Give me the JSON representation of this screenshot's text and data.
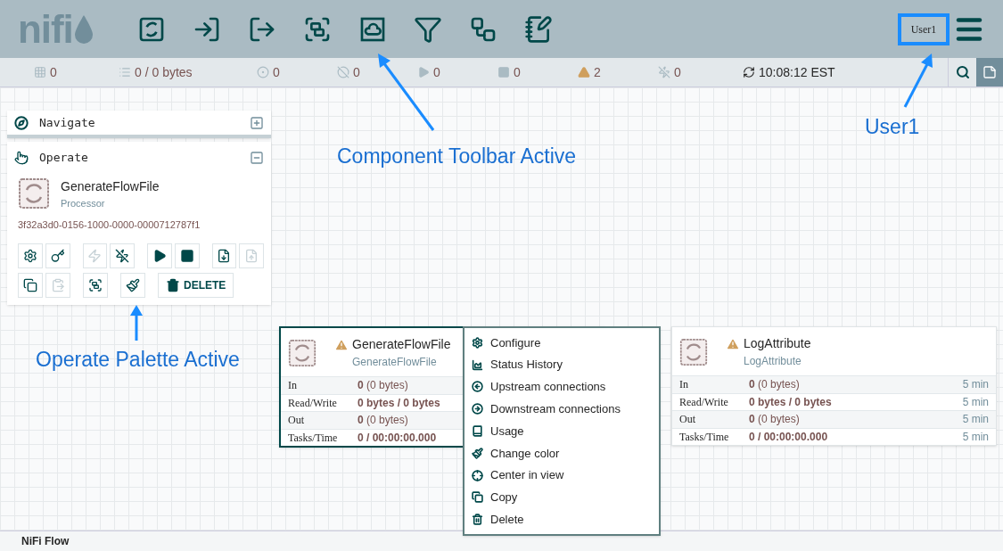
{
  "header": {
    "logo": "nifi",
    "user": "User1"
  },
  "status_bar": [
    {
      "text": "0"
    },
    {
      "text": "0 / 0 bytes"
    },
    {
      "text": "0"
    },
    {
      "text": "0"
    },
    {
      "text": "0"
    },
    {
      "text": "0"
    },
    {
      "text": "2"
    },
    {
      "text": "0"
    },
    {
      "text": "10:08:12 EST"
    }
  ],
  "navigate": {
    "title": "Navigate",
    "expanded": false
  },
  "operate": {
    "title": "Operate",
    "expanded": true,
    "name": "GenerateFlowFile",
    "type": "Processor",
    "id": "3f32a3d0-0156-1000-0000-0000712787f1",
    "buttons": [
      {
        "disabled": false
      },
      {
        "disabled": false
      },
      {
        "disabled": true
      },
      {
        "disabled": false
      },
      {
        "disabled": false
      },
      {
        "disabled": false
      },
      {
        "disabled": false
      },
      {
        "disabled": true
      },
      {
        "disabled": false
      },
      {
        "disabled": true
      },
      {
        "disabled": false
      },
      {
        "disabled": false
      },
      {
        "disabled": false,
        "label": "DELETE"
      }
    ]
  },
  "processors": [
    {
      "name": "GenerateFlowFile",
      "type": "GenerateFlowFile",
      "selected": true,
      "stats": [
        {
          "label": "In",
          "value": "**0** (0 bytes)"
        },
        {
          "label": "Read/Write",
          "value": "**0 bytes / 0 bytes**"
        },
        {
          "label": "Out",
          "value": "**0** (0 bytes)"
        },
        {
          "label": "Tasks/Time",
          "value": "**0 / 00:00:00.000**"
        }
      ]
    },
    {
      "name": "LogAttribute",
      "type": "LogAttribute",
      "selected": false,
      "stats": [
        {
          "label": "In",
          "value": "**0** (0 bytes)",
          "window": "5 min"
        },
        {
          "label": "Read/Write",
          "value": "**0 bytes / 0 bytes**",
          "window": "5 min"
        },
        {
          "label": "Out",
          "value": "**0** (0 bytes)",
          "window": "5 min"
        },
        {
          "label": "Tasks/Time",
          "value": "**0 / 00:00:00.000**",
          "window": "5 min"
        }
      ]
    }
  ],
  "context_menu": [
    "Configure",
    "Status History",
    "Upstream connections",
    "Downstream connections",
    "Usage",
    "Change color",
    "Center in view",
    "Copy",
    "Delete"
  ],
  "annotations": [
    "Component Toolbar Active",
    "User1",
    "Operate Palette Active"
  ],
  "breadcrumb": "NiFi Flow"
}
